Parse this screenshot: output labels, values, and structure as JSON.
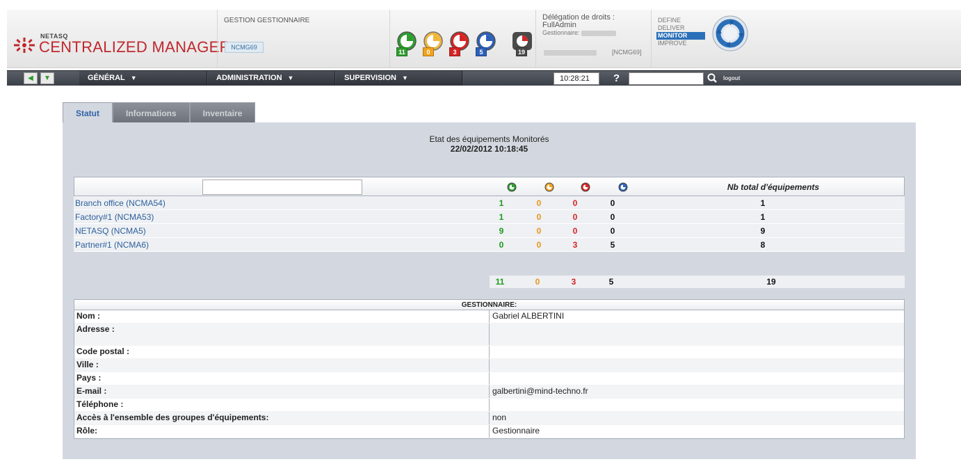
{
  "header": {
    "brand_small": "NETASQ",
    "brand_big": "CENTRALIZED MANAGER",
    "management_title": "GESTION GESTIONNAIRE",
    "management_chip": "NCMG69",
    "status_badges": [
      {
        "icon": "status-green-icon",
        "count": "11",
        "color": "#2e9d2e"
      },
      {
        "icon": "status-orange-icon",
        "count": "0",
        "color": "#f0a21d"
      },
      {
        "icon": "status-red-icon",
        "count": "3",
        "color": "#d42424"
      },
      {
        "icon": "status-blue-icon",
        "count": "5",
        "color": "#2c5fb8"
      },
      {
        "icon": "status-total-icon",
        "count": "19",
        "color": "#4a4a4a"
      }
    ],
    "delegation_label": "Délégation de droits :",
    "delegation_value": "FullAdmin",
    "gestionnaire_label": "Gestionnaire:",
    "gestionnaire_code": "[NCMG69]",
    "cycle": [
      "DEFINE",
      "DELIVER",
      "MONITOR",
      "IMPROVE"
    ],
    "cycle_active": "MONITOR"
  },
  "navbar": {
    "menus": [
      "GÉNÉRAL",
      "ADMINISTRATION",
      "SUPERVISION"
    ],
    "time": "10:28:21",
    "help": "?",
    "search_placeholder": "",
    "logout": "logout"
  },
  "tabs": [
    "Statut",
    "Informations",
    "Inventaire"
  ],
  "active_tab": "Statut",
  "status": {
    "title": "Etat des équipements Monitorés",
    "date": "22/02/2012 10:18:45",
    "filter_value": "",
    "total_header": "Nb total d'équipements",
    "column_icons": [
      "status-green-icon",
      "status-orange-icon",
      "status-red-icon",
      "status-blue-icon"
    ],
    "rows": [
      {
        "name": "Branch office (NCMA54)",
        "green": "1",
        "orange": "0",
        "red": "0",
        "blue": "0",
        "total": "1"
      },
      {
        "name": "Factory#1 (NCMA53)",
        "green": "1",
        "orange": "0",
        "red": "0",
        "blue": "0",
        "total": "1"
      },
      {
        "name": "NETASQ (NCMA5)",
        "green": "9",
        "orange": "0",
        "red": "0",
        "blue": "0",
        "total": "9"
      },
      {
        "name": "Partner#1 (NCMA6)",
        "green": "0",
        "orange": "0",
        "red": "3",
        "blue": "5",
        "total": "8"
      }
    ],
    "totals": {
      "green": "11",
      "orange": "0",
      "red": "3",
      "blue": "5",
      "total": "19"
    }
  },
  "gestionnaire": {
    "heading": "GESTIONNAIRE:",
    "fields": [
      {
        "label": "Nom :",
        "value": "Gabriel ALBERTINI"
      },
      {
        "label": "Adresse :",
        "value": ""
      },
      {
        "label": "Code postal :",
        "value": ""
      },
      {
        "label": "Ville :",
        "value": ""
      },
      {
        "label": "Pays :",
        "value": ""
      },
      {
        "label": "E-mail :",
        "value": "galbertini@mind-techno.fr"
      },
      {
        "label": "Téléphone :",
        "value": ""
      },
      {
        "label": "Accès à l'ensemble des groupes d'équipements:",
        "value": "non"
      },
      {
        "label": "Rôle:",
        "value": "Gestionnaire"
      }
    ]
  }
}
